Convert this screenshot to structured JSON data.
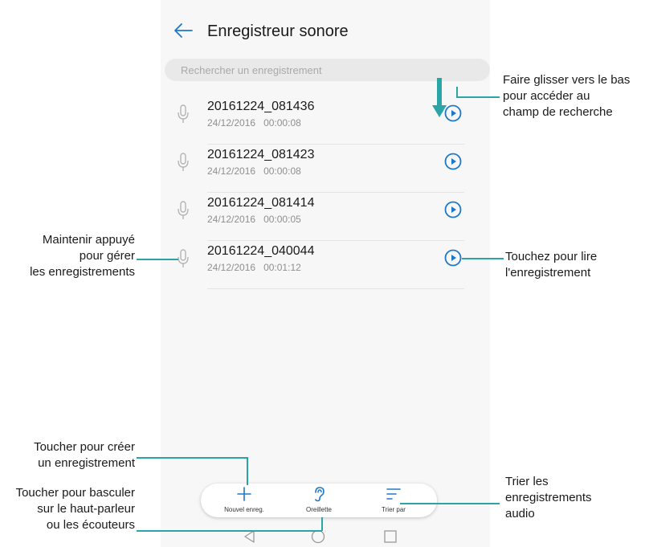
{
  "app": {
    "title": "Enregistreur sonore",
    "back_icon": "arrow-left-icon",
    "accent_color": "#1e78c8",
    "callout_line_color": "#2aa4a4"
  },
  "search": {
    "placeholder": "Rechercher un enregistrement"
  },
  "recordings": [
    {
      "name": "20161224_081436",
      "date": "24/12/2016",
      "duration": "00:00:08"
    },
    {
      "name": "20161224_081423",
      "date": "24/12/2016",
      "duration": "00:00:08"
    },
    {
      "name": "20161224_081414",
      "date": "24/12/2016",
      "duration": "00:00:05"
    },
    {
      "name": "20161224_040044",
      "date": "24/12/2016",
      "duration": "00:01:12"
    }
  ],
  "bottom_bar": {
    "new_label": "Nouvel enreg.",
    "earpiece_label": "Oreillette",
    "sort_label": "Trier par"
  },
  "navbar": {
    "icons": [
      "back-triangle-icon",
      "home-circle-icon",
      "recents-square-icon"
    ]
  },
  "callouts": {
    "swipe_down": [
      "Faire glisser vers le bas",
      "pour accéder au",
      "champ de recherche"
    ],
    "long_press": [
      "Maintenir appuyé",
      "pour gérer",
      "les enregistrements"
    ],
    "tap_play": [
      "Touchez pour lire",
      "l'enregistrement"
    ],
    "create": [
      "Toucher pour créer",
      "un enregistrement"
    ],
    "toggle_audio": [
      "Toucher pour basculer",
      "sur le haut-parleur",
      "ou les écouteurs"
    ],
    "sort": [
      "Trier les",
      "enregistrements",
      "audio"
    ]
  }
}
